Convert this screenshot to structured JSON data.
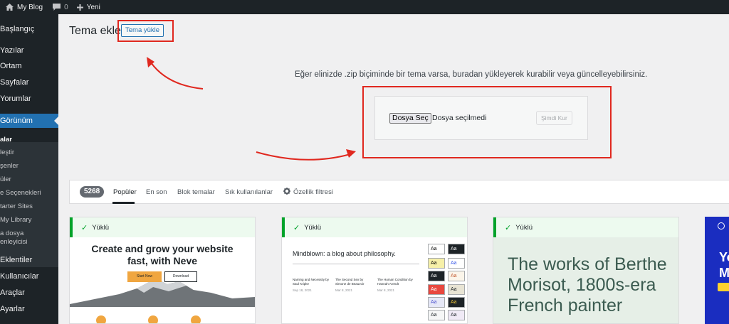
{
  "admin_bar": {
    "site_name": "My Blog",
    "comments_count": "0",
    "new_label": "Yeni"
  },
  "sidebar": {
    "items": [
      {
        "label": "Başlangıç"
      },
      {
        "label": "Yazılar"
      },
      {
        "label": "Ortam"
      },
      {
        "label": "Sayfalar"
      },
      {
        "label": "Yorumlar"
      },
      {
        "label": "Görünüm"
      },
      {
        "label": "Eklentiler"
      },
      {
        "label": "Kullanıcılar"
      },
      {
        "label": "Araçlar"
      },
      {
        "label": "Ayarlar"
      }
    ],
    "subitems": [
      {
        "label": "alar"
      },
      {
        "label": "leştir"
      },
      {
        "label": "şenler"
      },
      {
        "label": "üler"
      },
      {
        "label": "e Seçenekleri"
      },
      {
        "label": "tarter Sites"
      },
      {
        "label": "My Library"
      },
      {
        "label": "a dosya"
      },
      {
        "label": "enleyicisi"
      }
    ]
  },
  "page": {
    "title": "Tema ekle",
    "upload_button": "Tema yükle"
  },
  "upload": {
    "description": "Eğer elinizde .zip biçiminde bir tema varsa, buradan yükleyerek kurabilir veya güncelleyebilirsiniz.",
    "file_button": "Dosya Seç",
    "file_status": "Dosya seçilmedi",
    "install_button": "Şimdi Kur"
  },
  "filter_bar": {
    "count": "5268",
    "tabs": [
      {
        "label": "Popüler"
      },
      {
        "label": "En son"
      },
      {
        "label": "Blok temalar"
      },
      {
        "label": "Sık kullanılanlar"
      }
    ],
    "feature_filter": "Özellik filtresi"
  },
  "themes": [
    {
      "installed_label": "Yüklü",
      "headline": "Create and grow your website fast, with Neve",
      "start_label": "Start Now",
      "download_label": "Download"
    },
    {
      "installed_label": "Yüklü",
      "blog_title": "Mindblown: a blog about philosophy.",
      "posts": [
        {
          "title": "Naming and Necessity by Saul Kripke",
          "date": "Sep 18, 2021"
        },
        {
          "title": "The Second Sex by Simone de Beauvoir",
          "date": "Mar 8, 2021"
        },
        {
          "title": "The Human Condition by Hannah Arendt",
          "date": "Mar 8, 2021"
        }
      ],
      "swatch_label": "Aa"
    },
    {
      "installed_label": "Yüklü",
      "headline": "The works of Berthe Morisot, 1800s-era French painter"
    },
    {
      "logo_text": "A",
      "headline_line1": "Yo",
      "headline_line2": "Ma"
    }
  ],
  "colors": {
    "admin_dark": "#1d2327",
    "accent_blue": "#2271b1",
    "annotation_red": "#e0281f",
    "installed_green": "#00a32a"
  }
}
